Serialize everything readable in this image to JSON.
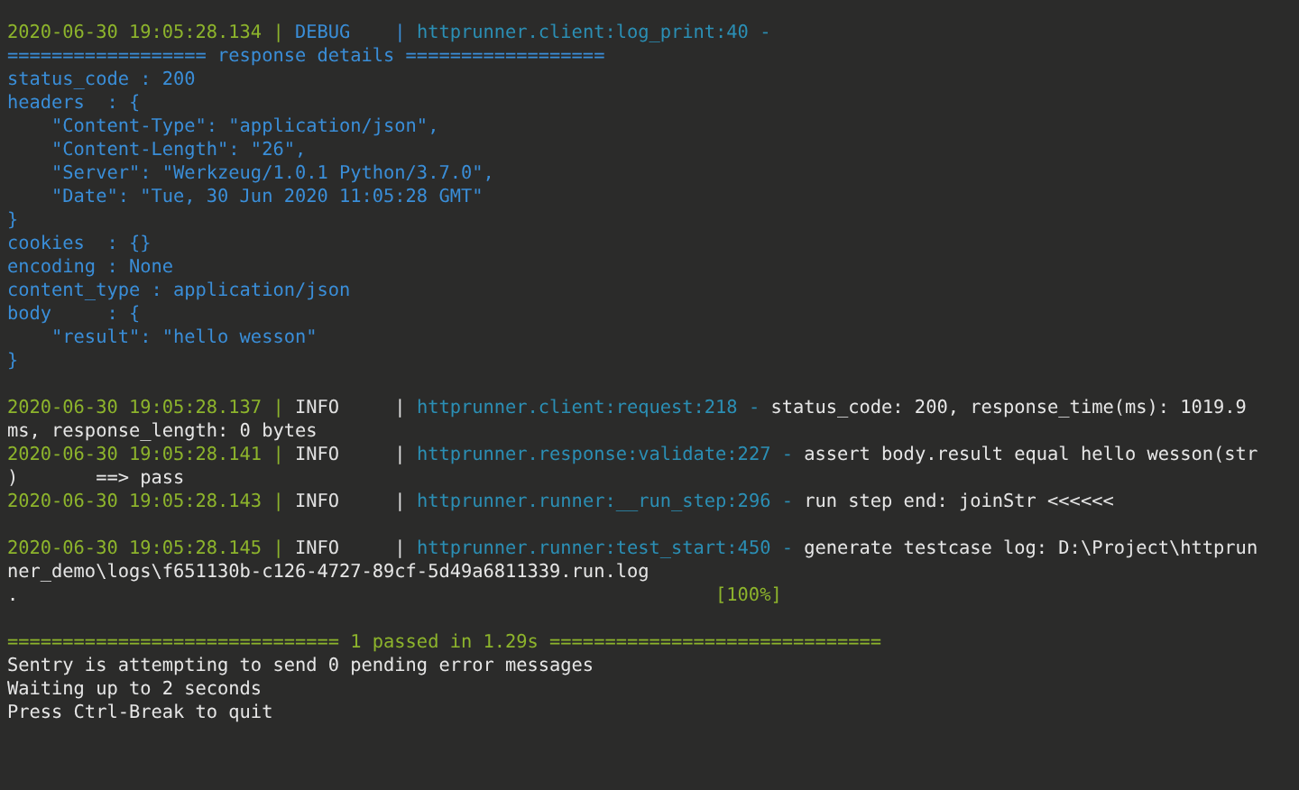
{
  "terminal": {
    "blocks": [
      {
        "lines": [
          {
            "segments": [
              {
                "kind": "time",
                "text": "2020-06-30 19:05:28.134 |"
              },
              {
                "kind": "debug",
                "text": "DEBUG    |"
              },
              {
                "kind": "source",
                "text": "httprunner.client:log_print:40 -"
              }
            ]
          },
          {
            "segments": [
              {
                "kind": "json",
                "text": "================== response details =================="
              }
            ]
          },
          {
            "segments": [
              {
                "kind": "json",
                "text": "status_code : 200"
              }
            ]
          },
          {
            "segments": [
              {
                "kind": "json",
                "text": "headers  : {"
              }
            ]
          },
          {
            "segments": [
              {
                "kind": "json",
                "text": "    \"Content-Type\": \"application/json\","
              }
            ]
          },
          {
            "segments": [
              {
                "kind": "json",
                "text": "    \"Content-Length\": \"26\","
              }
            ]
          },
          {
            "segments": [
              {
                "kind": "json",
                "text": "    \"Server\": \"Werkzeug/1.0.1 Python/3.7.0\","
              }
            ]
          },
          {
            "segments": [
              {
                "kind": "json",
                "text": "    \"Date\": \"Tue, 30 Jun 2020 11:05:28 GMT\""
              }
            ]
          },
          {
            "segments": [
              {
                "kind": "json",
                "text": "}"
              }
            ]
          },
          {
            "segments": [
              {
                "kind": "json",
                "text": "cookies  : {}"
              }
            ]
          },
          {
            "segments": [
              {
                "kind": "json",
                "text": "encoding : None"
              }
            ]
          },
          {
            "segments": [
              {
                "kind": "json",
                "text": "content_type : application/json"
              }
            ]
          },
          {
            "segments": [
              {
                "kind": "json",
                "text": "body     : {"
              }
            ]
          },
          {
            "segments": [
              {
                "kind": "json",
                "text": "    \"result\": \"hello wesson\""
              }
            ]
          },
          {
            "segments": [
              {
                "kind": "json",
                "text": "}"
              }
            ]
          }
        ]
      },
      {
        "lines": [
          {
            "segments": [
              {
                "kind": "time",
                "text": "2020-06-30 19:05:28.137 |"
              },
              {
                "kind": "info",
                "text": "INFO     |"
              },
              {
                "kind": "source",
                "text": "httprunner.client:request:218 -"
              },
              {
                "kind": "message",
                "text": "status_code: 200, response_time(ms): 1019.9"
              }
            ]
          },
          {
            "segments": [
              {
                "kind": "message",
                "text": "ms, response_length: 0 bytes"
              }
            ]
          },
          {
            "segments": [
              {
                "kind": "time",
                "text": "2020-06-30 19:05:28.141 |"
              },
              {
                "kind": "info",
                "text": "INFO     |"
              },
              {
                "kind": "source",
                "text": "httprunner.response:validate:227 -"
              },
              {
                "kind": "message",
                "text": "assert body.result equal hello wesson(str"
              }
            ]
          },
          {
            "segments": [
              {
                "kind": "message",
                "text": ")       ==> pass"
              }
            ]
          },
          {
            "segments": [
              {
                "kind": "time",
                "text": "2020-06-30 19:05:28.143 |"
              },
              {
                "kind": "info",
                "text": "INFO     |"
              },
              {
                "kind": "source",
                "text": "httprunner.runner:__run_step:296 -"
              },
              {
                "kind": "message",
                "text": "run step end: joinStr <<<<<<"
              }
            ]
          }
        ]
      },
      {
        "lines": [
          {
            "segments": [
              {
                "kind": "time",
                "text": "2020-06-30 19:05:28.145 |"
              },
              {
                "kind": "info",
                "text": "INFO     |"
              },
              {
                "kind": "source",
                "text": "httprunner.runner:test_start:450 -"
              },
              {
                "kind": "message",
                "text": "generate testcase log: D:\\Project\\httprun"
              }
            ]
          },
          {
            "segments": [
              {
                "kind": "message",
                "text": "ner_demo\\logs\\f651130b-c126-4727-89cf-5d49a6811339.run.log"
              }
            ]
          },
          {
            "segments": [
              {
                "kind": "message",
                "text": "."
              },
              {
                "kind": "progress",
                "text": "[100%]"
              }
            ]
          }
        ]
      },
      {
        "lines": [
          {
            "segments": [
              {
                "kind": "summary",
                "text": "============================== 1 passed in 1.29s =============================="
              }
            ]
          },
          {
            "segments": [
              {
                "kind": "message",
                "text": "Sentry is attempting to send 0 pending error messages"
              }
            ]
          },
          {
            "segments": [
              {
                "kind": "message",
                "text": "Waiting up to 2 seconds"
              }
            ]
          },
          {
            "segments": [
              {
                "kind": "message",
                "text": "Press Ctrl-Break to quit"
              }
            ]
          }
        ]
      }
    ]
  }
}
